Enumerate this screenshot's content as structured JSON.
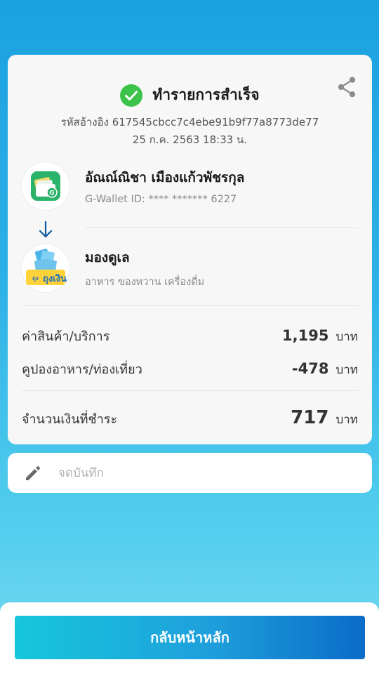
{
  "status": {
    "title": "ทำรายการสำเร็จ",
    "reference": "รหัสอ้างอิง 617545cbcc7c4ebe91b9f77a8773de77",
    "datetime": "25 ก.ค. 2563 18:33 น."
  },
  "sender": {
    "name": "อัณณ์ณิชา เมืองแก้วพัชรกุล",
    "subtitle": "G-Wallet ID: **** ******* 6227",
    "icon": "g-wallet-app-icon"
  },
  "receiver": {
    "name": "มองดูเล",
    "subtitle": "อาหาร ของหวาน เครื่องดื่ม",
    "icon": "thung-ngoen-icon",
    "logo_text": "ถุงเงิน"
  },
  "lines": [
    {
      "label": "ค่าสินค้า/บริการ",
      "amount": "1,195",
      "currency": "บาท"
    },
    {
      "label": "คูปองอาหาร/ท่องเที่ยว",
      "amount": "-478",
      "currency": "บาท"
    }
  ],
  "total": {
    "label": "จำนวนเงินที่ชำระ",
    "amount": "717",
    "currency": "บาท"
  },
  "note": {
    "placeholder": "จดบันทึก"
  },
  "home_button": {
    "label": "กลับหน้าหลัก"
  },
  "colors": {
    "success": "#3cc34a",
    "accent": "#1fa0dc",
    "arrow": "#0c5a9e"
  }
}
